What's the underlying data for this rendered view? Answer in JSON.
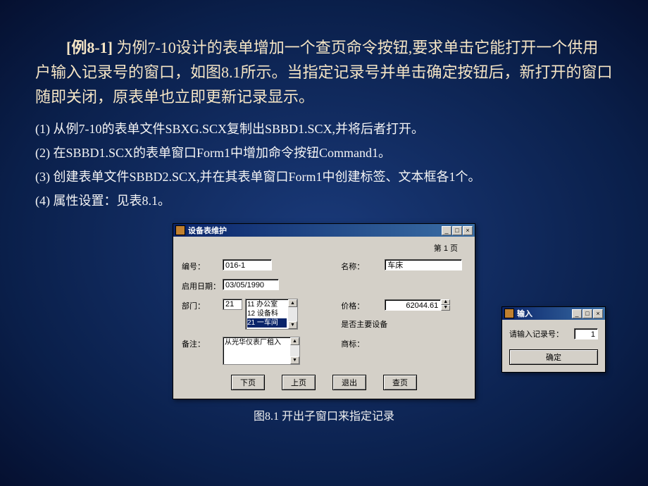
{
  "para": {
    "title_label": "[例8-1]",
    "title_rest": " 为例7-10设计的表单增加一个查页命令按钮,要求单击它能打开一个供用户输入记录号的窗口，如图8.1所示。当指定记录号并单击确定按钮后，新打开的窗口随即关闭，原表单也立即更新记录显示。"
  },
  "steps": {
    "s1": "(1) 从例7-10的表单文件SBXG.SCX复制出SBBD1.SCX,并将后者打开。",
    "s2": "(2) 在SBBD1.SCX的表单窗口Form1中增加命令按钮Command1。",
    "s3": "(3) 创建表单文件SBBD2.SCX,并在其表单窗口Form1中创建标签、文本框各1个。",
    "s4": "(4) 属性设置：见表8.1。"
  },
  "mainwin": {
    "title": "设备表维护",
    "page_label": "第 1 页",
    "labels": {
      "bianhao": "编号：",
      "mingcheng": "名称：",
      "qiyong": "启用日期：",
      "bumen": "部门：",
      "jiage": "价格：",
      "zhuyao": "是否主要设备",
      "beizhu": "备注：",
      "shangbiao": "商标："
    },
    "values": {
      "bianhao": "016-1",
      "mingcheng": "车床",
      "qiyong": "03/05/1990",
      "bumen": "21",
      "jiage": "62044.61"
    },
    "dept_list": {
      "r1": "11 办公室",
      "r2": "12 设备科",
      "r3": "21 一车间"
    },
    "memo": "从光华仪表厂租入",
    "buttons": {
      "next": "下页",
      "prev": "上页",
      "exit": "退出",
      "find": "查页"
    }
  },
  "inputwin": {
    "title": "输入",
    "prompt": "请输入记录号：",
    "value": "1",
    "ok": "确定"
  },
  "caption": "图8.1 开出子窗口来指定记录"
}
